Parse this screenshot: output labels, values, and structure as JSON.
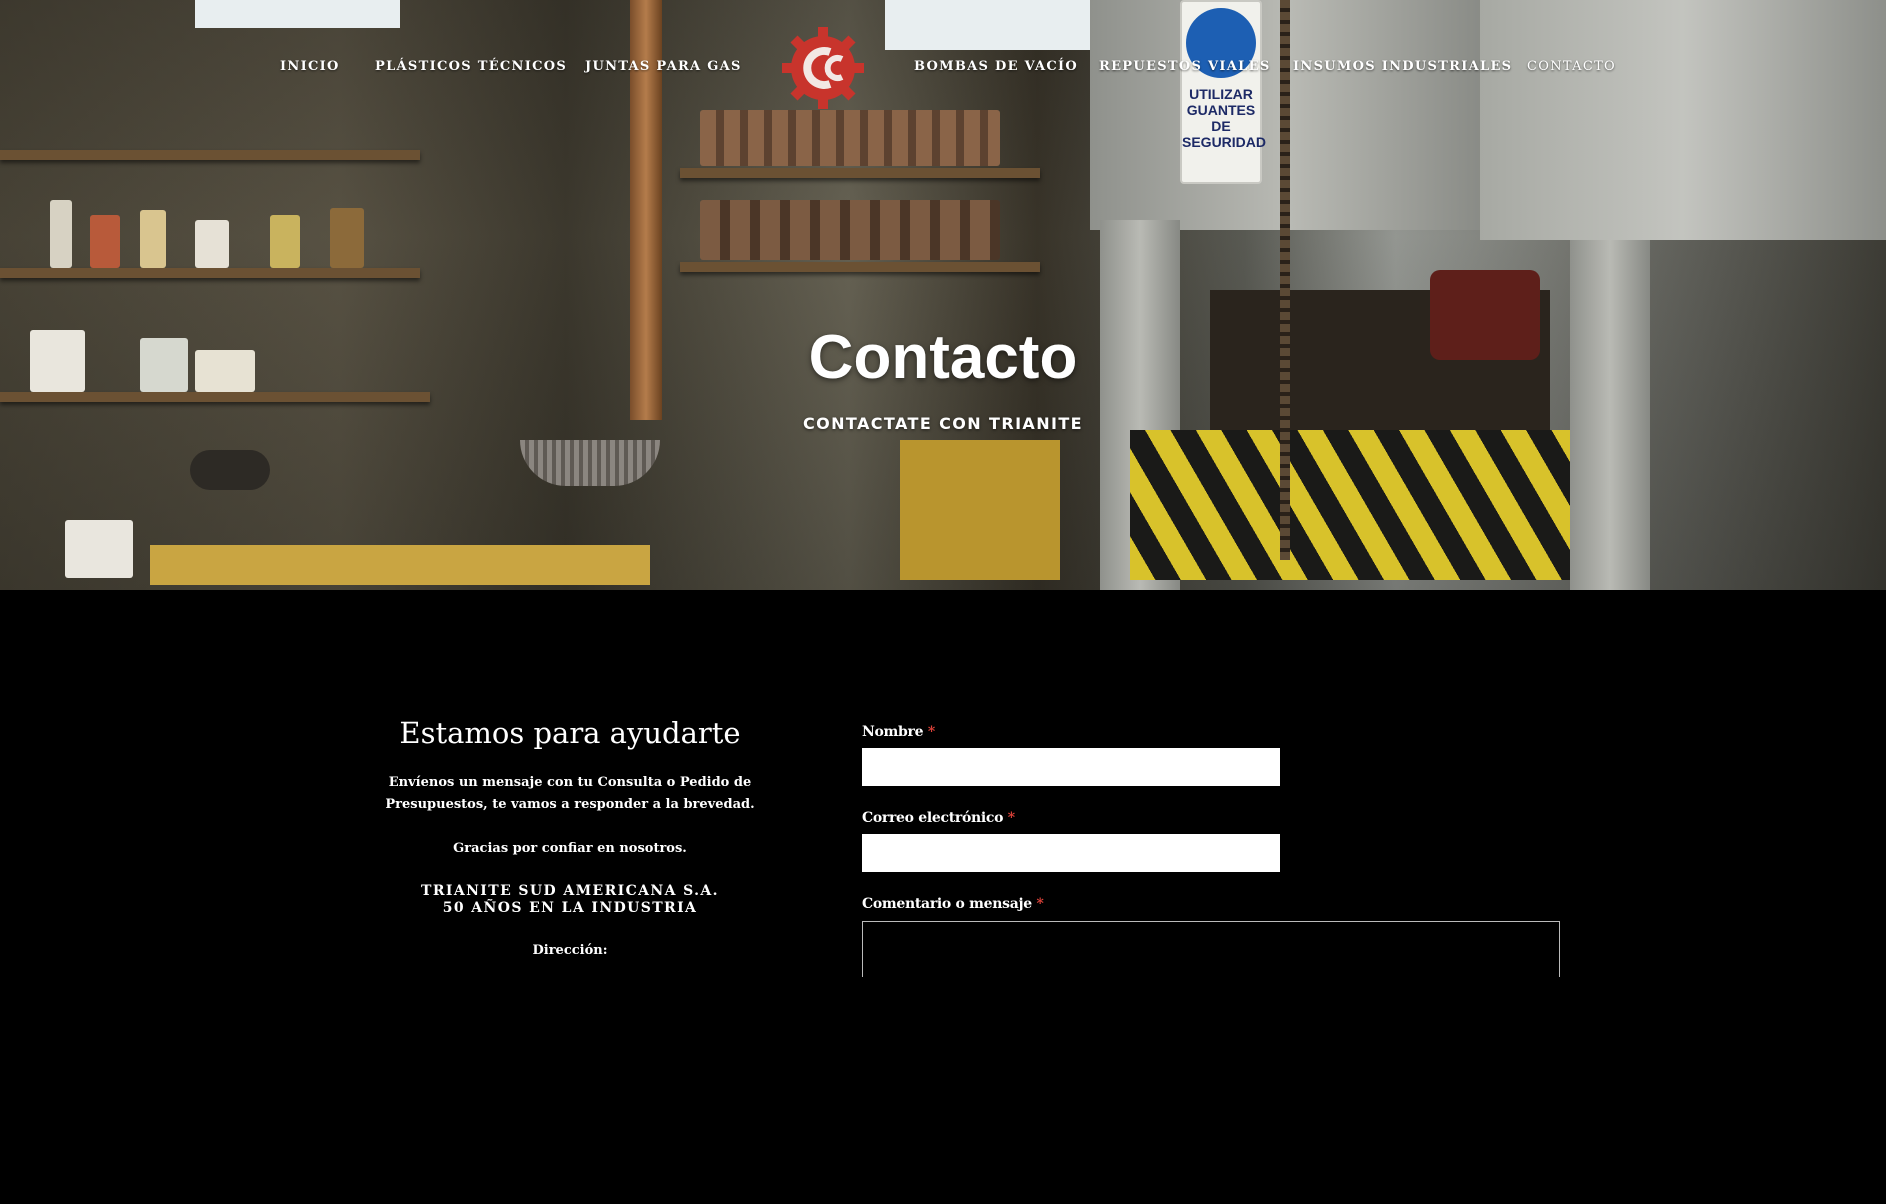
{
  "nav": {
    "left": [
      "INICIO",
      "PLÁSTICOS TÉCNICOS",
      "JUNTAS PARA GAS"
    ],
    "right": [
      "BOMBAS DE VACÍO",
      "REPUESTOS VIALES",
      "INSUMOS INDUSTRIALES",
      "CONTACTO"
    ],
    "active": "CONTACTO"
  },
  "logo": {
    "name": "trianite-gear-logo",
    "color": "#c8342c"
  },
  "hero": {
    "title": "Contacto",
    "subtitle": "CONTACTATE CON TRIANITE",
    "sign_text": "UTILIZAR GUANTES DE SEGURIDAD"
  },
  "info": {
    "heading": "Estamos para ayudarte",
    "message": "Envíenos un mensaje con tu Consulta o Pedido de Presupuestos, te vamos a responder a la brevedad.",
    "thanks": "Gracias por confiar en nosotros.",
    "company_line1": "TRIANITE SUD AMERICANA S.A.",
    "company_line2": "50 AÑOS EN LA INDUSTRIA",
    "address_label": "Dirección:"
  },
  "form": {
    "name_label": "Nombre",
    "email_label": "Correo electrónico",
    "message_label": "Comentario o mensaje",
    "required_mark": "*",
    "name_value": "",
    "email_value": "",
    "message_value": ""
  },
  "colors": {
    "accent": "#c8342c",
    "background": "#000000",
    "required": "#e0433a"
  }
}
